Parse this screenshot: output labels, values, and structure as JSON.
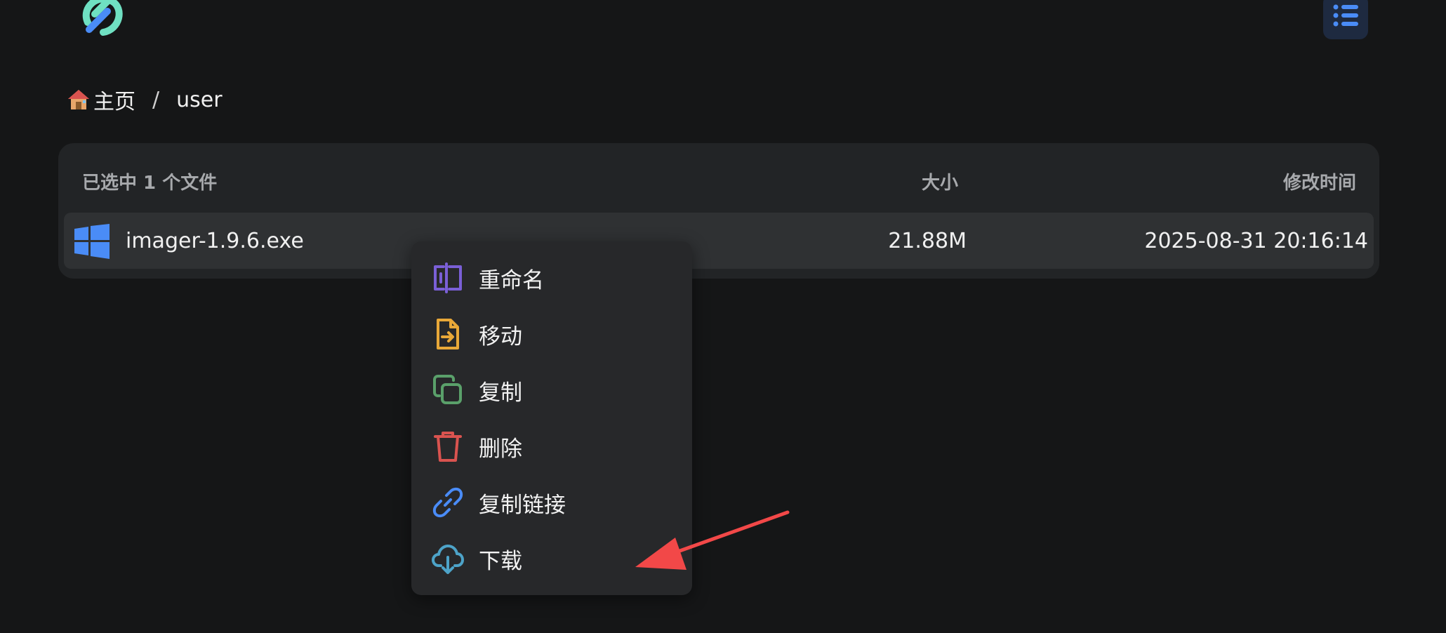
{
  "header": {
    "logo_icon": "brand-logo",
    "menu_icon": "list-icon",
    "accent_color": "#4a8cf7"
  },
  "breadcrumb": {
    "home_icon": "house-emoji",
    "home_label": "主页",
    "separator": "/",
    "current": "user"
  },
  "file_table": {
    "selected_count_label": "已选中 1 个文件",
    "col_size": "大小",
    "col_mtime": "修改时间",
    "rows": [
      {
        "icon": "windows-icon",
        "name": "imager-1.9.6.exe",
        "size": "21.88M",
        "modified": "2025-08-31 20:16:14",
        "selected": true
      }
    ]
  },
  "context_menu": {
    "items": [
      {
        "label": "重命名",
        "icon": "rename-icon",
        "color": "#7a5fd6"
      },
      {
        "label": "移动",
        "icon": "move-file-icon",
        "color": "#e8a838"
      },
      {
        "label": "复制",
        "icon": "copy-icon",
        "color": "#5aa06a"
      },
      {
        "label": "删除",
        "icon": "trash-icon",
        "color": "#d9534f"
      },
      {
        "label": "复制链接",
        "icon": "link-icon",
        "color": "#4a8cf7"
      },
      {
        "label": "下载",
        "icon": "cloud-download-icon",
        "color": "#4da3c8"
      }
    ]
  },
  "annotation": {
    "arrow_color": "#f24848",
    "points_to": "下载"
  }
}
